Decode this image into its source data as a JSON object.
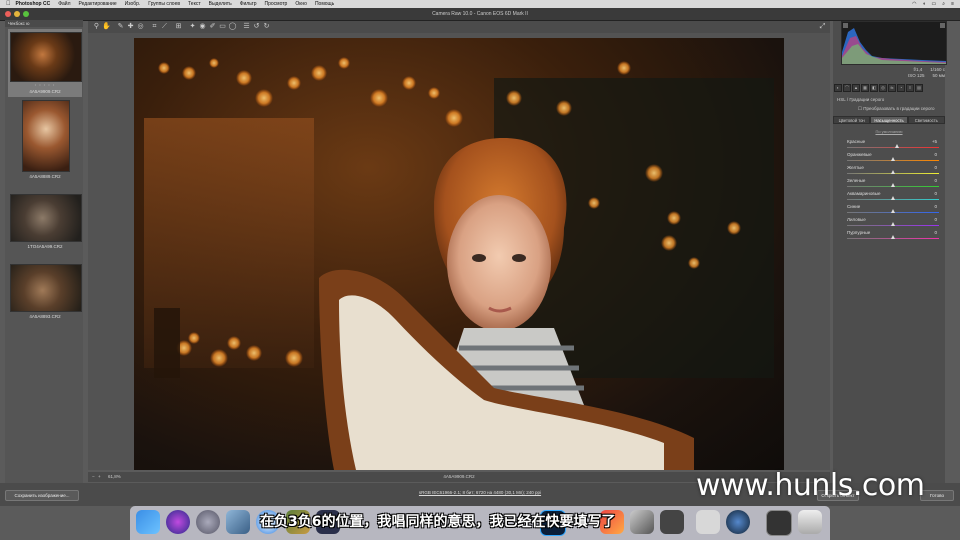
{
  "menubar": {
    "app": "Photoshop CC",
    "items": [
      "Файл",
      "Редактирование",
      "Изобр.",
      "Группы слоев",
      "Текст",
      "Выделить",
      "Фильтр",
      "Просмотр",
      "Окно",
      "Помощь"
    ]
  },
  "window": {
    "title": "Camera Raw 10.0  -  Canon EOS 6D Mark II"
  },
  "filmstrip": {
    "header": "Чекбокс ю",
    "thumbs": [
      {
        "caption": "4A5A9909.CR2",
        "stars": "• • • • •"
      },
      {
        "caption": "4A5A8889.CR2"
      },
      {
        "caption": "1TO4A5A99.CR2"
      },
      {
        "caption": "4A5A8893.CR2"
      }
    ]
  },
  "canvas": {
    "filename": "4A5A9909.CR2",
    "zoom": "61,8%"
  },
  "histogram": {
    "readout": [
      [
        "f/1,4",
        "1/160 с"
      ],
      [
        "ISO 125",
        "50 мм"
      ]
    ]
  },
  "panel": {
    "title": "HSL / Градации серого",
    "checkbox": "Преобразовать в градации серого",
    "tabs": [
      "Цветовой тон",
      "Насыщенность",
      "Светимость"
    ],
    "default_link": "По умолчанию",
    "sliders": [
      {
        "label": "Красные",
        "value": "+5"
      },
      {
        "label": "Оранжевые",
        "value": "0"
      },
      {
        "label": "Желтые",
        "value": "0"
      },
      {
        "label": "Зеленые",
        "value": "0"
      },
      {
        "label": "Аквамариновые",
        "value": "0"
      },
      {
        "label": "Синие",
        "value": "0"
      },
      {
        "label": "Лиловые",
        "value": "0"
      },
      {
        "label": "Пурпурные",
        "value": "0"
      }
    ]
  },
  "bottombar": {
    "save_label": "Сохранить изображение...",
    "info_link": "sRGB IEC61966-2.1; 8 бит; 6720 на 4480 (30,1 Мп); 240 ppi",
    "open_label": "Открыть объект",
    "done_label": "Готово"
  },
  "overlay": {
    "watermark": "www.hunls.com",
    "subtitle": "在负3负6的位置，我唱同样的意思，我已经在快要填写了"
  },
  "colors": {
    "accent": "#4f8ff7",
    "panel_bg": "#4d4d4d"
  }
}
